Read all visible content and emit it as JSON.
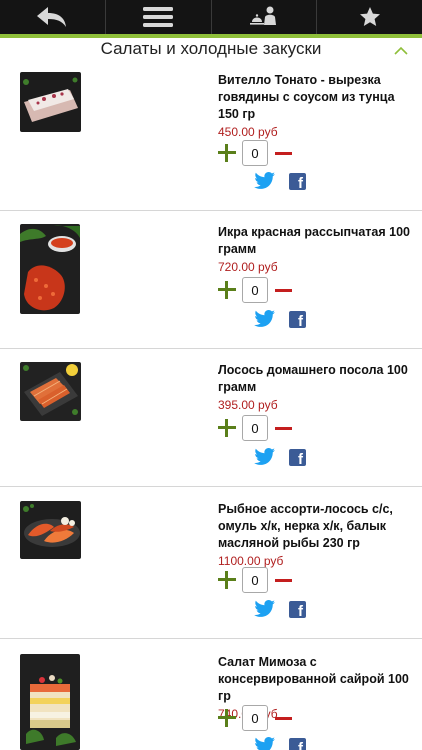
{
  "nav": {
    "buttons": [
      {
        "icon": "back-arrow-icon"
      },
      {
        "icon": "menu-icon"
      },
      {
        "icon": "waiter-cloche-icon"
      },
      {
        "icon": "star-icon"
      }
    ]
  },
  "colors": {
    "accent_green": "#8fbf3a",
    "price_red": "#b01f1f",
    "plus_green": "#5a7f1a",
    "minus_red": "#c41e1e",
    "facebook_blue": "#3b5b96",
    "twitter_blue": "#1da1f2"
  },
  "section": {
    "title": "Салаты и холодные закуски",
    "collapse_icon": "chevron-up-icon"
  },
  "items": [
    {
      "name": "Вителло Тонато - вырезка говядины с соусом из тунца 150 гр",
      "price": "450.00 руб",
      "quantity": "0"
    },
    {
      "name": "Икра красная рассыпчатая 100 грамм",
      "price": "720.00 руб",
      "quantity": "0"
    },
    {
      "name": "Лосось домашнего посола 100 грамм",
      "price": "395.00 руб",
      "quantity": "0"
    },
    {
      "name": "Рыбное ассорти-лосось с/с, омуль х/к, нерка х/к, балык масляной рыбы 230 гр",
      "price": "1100.00 руб",
      "quantity": "0"
    },
    {
      "name": "Салат Мимоза с консервированной сайрой 100 гр",
      "price": "740.00 руб",
      "quantity": "0"
    }
  ]
}
